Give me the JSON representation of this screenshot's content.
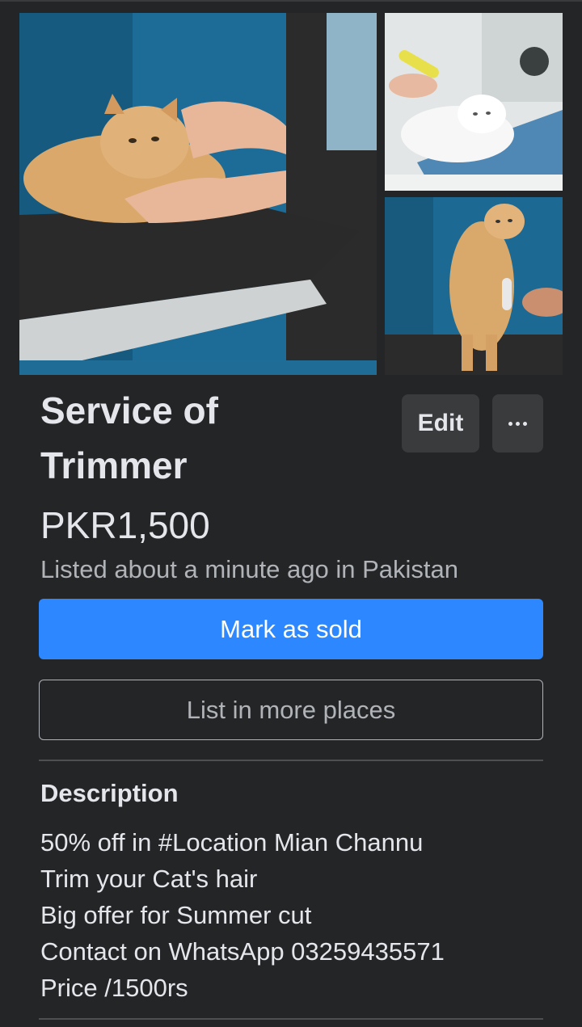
{
  "listing": {
    "title_line1": "Service of",
    "title_line2": "Trimmer",
    "price": "PKR1,500",
    "listed_text": "Listed about a minute ago in Pakistan"
  },
  "actions": {
    "edit_label": "Edit",
    "more_icon": "more-horizontal-icon",
    "mark_sold_label": "Mark as sold",
    "list_more_label": "List in more places"
  },
  "description": {
    "heading": "Description",
    "lines": [
      "50% off in #Location Mian Channu",
      "Trim your Cat's hair",
      "Big offer for Summer cut",
      "Contact on WhatsApp 03259435571",
      "Price /1500rs"
    ]
  },
  "colors": {
    "background": "#242526",
    "primary_button": "#2d88ff",
    "secondary_button": "#3a3b3c",
    "text_primary": "#e4e6eb",
    "text_secondary": "#b0b3b8"
  }
}
